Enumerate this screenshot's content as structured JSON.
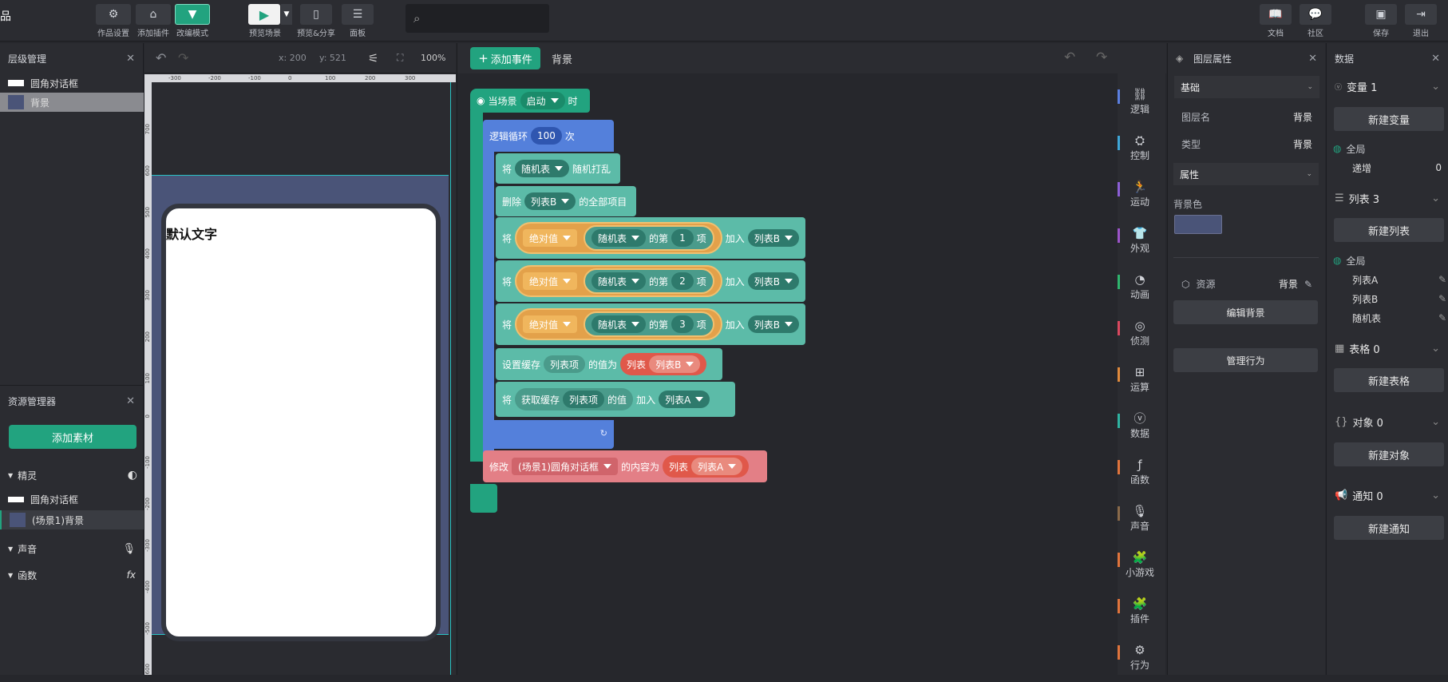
{
  "topbar": {
    "app_fragment": "品",
    "buttons": [
      {
        "label": "作品设置"
      },
      {
        "label": "添加插件"
      },
      {
        "label": "改编模式"
      },
      {
        "label": "预览场景"
      },
      {
        "label": "预览&分享"
      },
      {
        "label": "面板"
      }
    ],
    "right_buttons": [
      {
        "label": "文档"
      },
      {
        "label": "社区"
      },
      {
        "label": "保存"
      },
      {
        "label": "退出"
      }
    ],
    "search_placeholder": ""
  },
  "layer_panel": {
    "title": "层级管理",
    "items": [
      {
        "label": "圆角对话框",
        "color": "#ffffff"
      },
      {
        "label": "背景",
        "color": "#4a5478"
      }
    ]
  },
  "resource_panel": {
    "title": "资源管理器",
    "add_button": "添加素材",
    "sections": {
      "sprites": "精灵",
      "sounds": "声音",
      "functions": "函数"
    },
    "sprite_items": [
      {
        "label": "圆角对话框",
        "color": "#ffffff"
      },
      {
        "label": "(场景1)背景",
        "color": "#4a5478"
      }
    ]
  },
  "stage": {
    "coord_x": "x: 200",
    "coord_y": "y: 521",
    "zoom": "100%",
    "ruler_top": [
      "-300",
      "-200",
      "-100",
      "0",
      "100",
      "200",
      "300"
    ],
    "ruler_left": [
      "700",
      "600",
      "500",
      "400",
      "300",
      "200",
      "100",
      "0",
      "-100",
      "-200",
      "-300",
      "-400",
      "-500",
      "-600"
    ],
    "dialog_text": "默认文字",
    "bg_color": "#4a5478"
  },
  "script": {
    "add_event": "添加事件",
    "scene_name": "背景",
    "hat": {
      "prefix": "当场景",
      "event": "启动",
      "suffix": "时"
    },
    "loop": {
      "label": "逻辑循环",
      "count": "100",
      "unit": "次"
    },
    "shuffle": {
      "prefix": "将",
      "list": "随机表",
      "suffix": "随机打乱"
    },
    "delete_all": {
      "prefix": "删除",
      "list": "列表B",
      "suffix": "的全部项目"
    },
    "add_rows": [
      {
        "prefix": "将",
        "op": "绝对值",
        "list": "随机表",
        "of": "的第",
        "index": "1",
        "item": "项",
        "add": "加入",
        "target": "列表B"
      },
      {
        "prefix": "将",
        "op": "绝对值",
        "list": "随机表",
        "of": "的第",
        "index": "2",
        "item": "项",
        "add": "加入",
        "target": "列表B"
      },
      {
        "prefix": "将",
        "op": "绝对值",
        "list": "随机表",
        "of": "的第",
        "index": "3",
        "item": "项",
        "add": "加入",
        "target": "列表B"
      }
    ],
    "set_cache": {
      "prefix": "设置缓存",
      "key": "列表项",
      "mid": "的值为",
      "list_label": "列表",
      "list": "列表B"
    },
    "get_cache": {
      "prefix": "将",
      "label": "获取缓存",
      "key": "列表项",
      "mid": "的值",
      "add": "加入",
      "target": "列表A"
    },
    "modify": {
      "prefix": "修改",
      "target": "(场景1)圆角对话框",
      "mid": "的内容为",
      "list_label": "列表",
      "list": "列表A"
    }
  },
  "categories": [
    {
      "label": "逻辑",
      "color": "#5b7fe0",
      "icon": "logic-icon"
    },
    {
      "label": "控制",
      "color": "#3fa7d8",
      "icon": "control-icon"
    },
    {
      "label": "运动",
      "color": "#8c5fd6",
      "icon": "motion-icon"
    },
    {
      "label": "外观",
      "color": "#9c54c9",
      "icon": "shirt-icon"
    },
    {
      "label": "动画",
      "color": "#2fb56e",
      "icon": "animation-icon"
    },
    {
      "label": "侦测",
      "color": "#d9485f",
      "icon": "sensor-icon"
    },
    {
      "label": "运算",
      "color": "#e08a3c",
      "icon": "operator-icon"
    },
    {
      "label": "数据",
      "color": "#2fb3a1",
      "icon": "data-icon"
    },
    {
      "label": "函数",
      "color": "#e0743c",
      "icon": "function-icon"
    },
    {
      "label": "声音",
      "color": "#8a6a4a",
      "icon": "microphone-icon"
    },
    {
      "label": "小游戏",
      "color": "#e0743c",
      "icon": "game-icon"
    },
    {
      "label": "插件",
      "color": "#e0743c",
      "icon": "plugin-icon"
    },
    {
      "label": "行为",
      "color": "#e0743c",
      "icon": "behavior-icon"
    }
  ],
  "properties": {
    "title": "图层属性",
    "basic": "基础",
    "layer_name_label": "图层名",
    "layer_name": "背景",
    "type_label": "类型",
    "type": "背景",
    "attr": "属性",
    "bg_color_label": "背景色",
    "bg_color": "#4a5478",
    "resource_label": "资源",
    "resource_value": "背景",
    "edit_bg": "编辑背景",
    "manage_behavior": "管理行为"
  },
  "data_panel": {
    "title": "数据",
    "variables": {
      "label": "变量 1",
      "new": "新建变量",
      "scope": "全局",
      "item": "递增",
      "value": "0"
    },
    "lists": {
      "label": "列表 3",
      "new": "新建列表",
      "scope": "全局",
      "items": [
        "列表A",
        "列表B",
        "随机表"
      ]
    },
    "tables": {
      "label": "表格 0",
      "new": "新建表格"
    },
    "objects": {
      "label": "对象 0",
      "new": "新建对象"
    },
    "notices": {
      "label": "通知 0",
      "new": "新建通知"
    }
  }
}
